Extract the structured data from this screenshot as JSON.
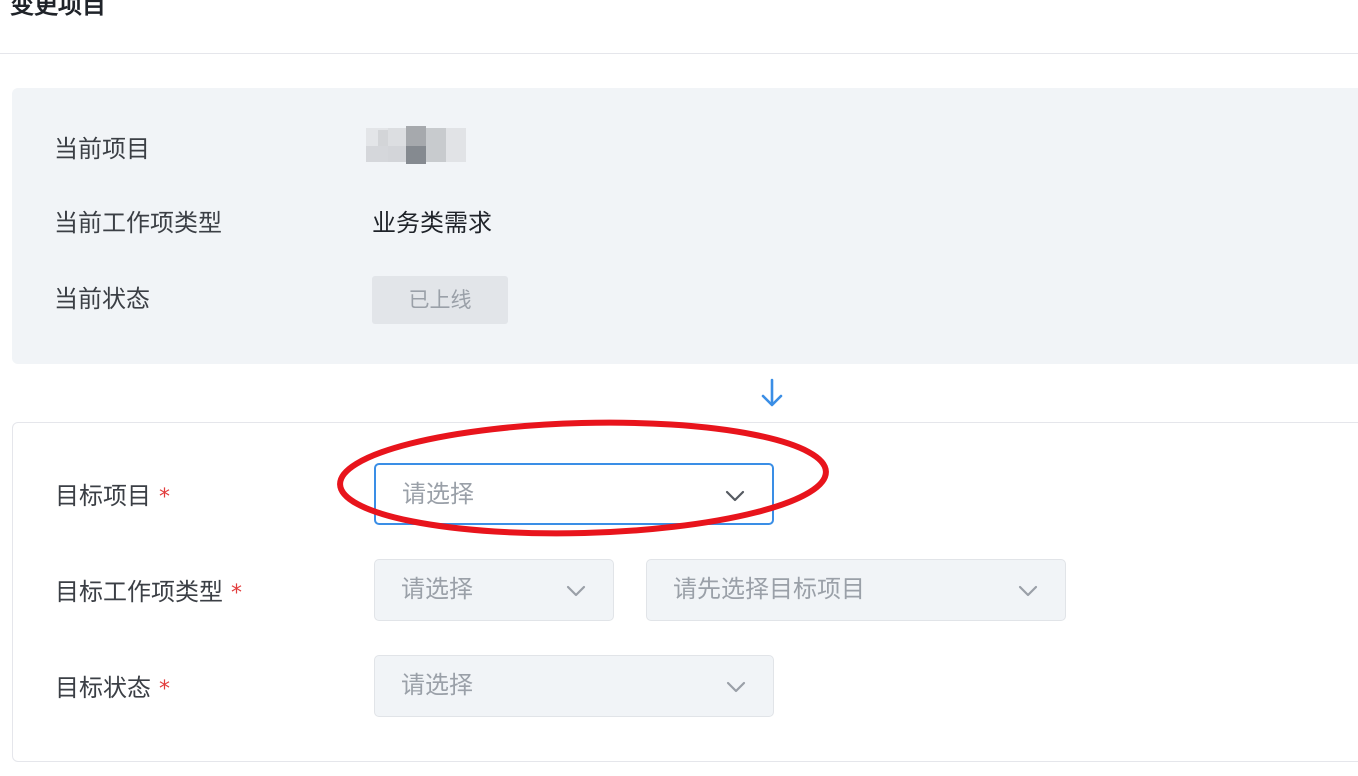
{
  "page": {
    "title": "变更项目"
  },
  "current": {
    "project_label": "当前项目",
    "type_label": "当前工作项类型",
    "type_value": "业务类需求",
    "status_label": "当前状态",
    "status_value": "已上线"
  },
  "target": {
    "project_label": "目标项目",
    "project_placeholder": "请选择",
    "type_label": "目标工作项类型",
    "type_placeholder": "请选择",
    "type_sub_placeholder": "请先选择目标项目",
    "status_label": "目标状态",
    "status_placeholder": "请选择",
    "required_mark": "*"
  },
  "icons": {
    "arrow": "arrow-down-icon",
    "chevron": "chevron-down-icon"
  },
  "colors": {
    "accent": "#3a8ee6",
    "required": "#e23c3c",
    "annotation": "#e8141c",
    "panel_bg": "#f1f4f7"
  }
}
